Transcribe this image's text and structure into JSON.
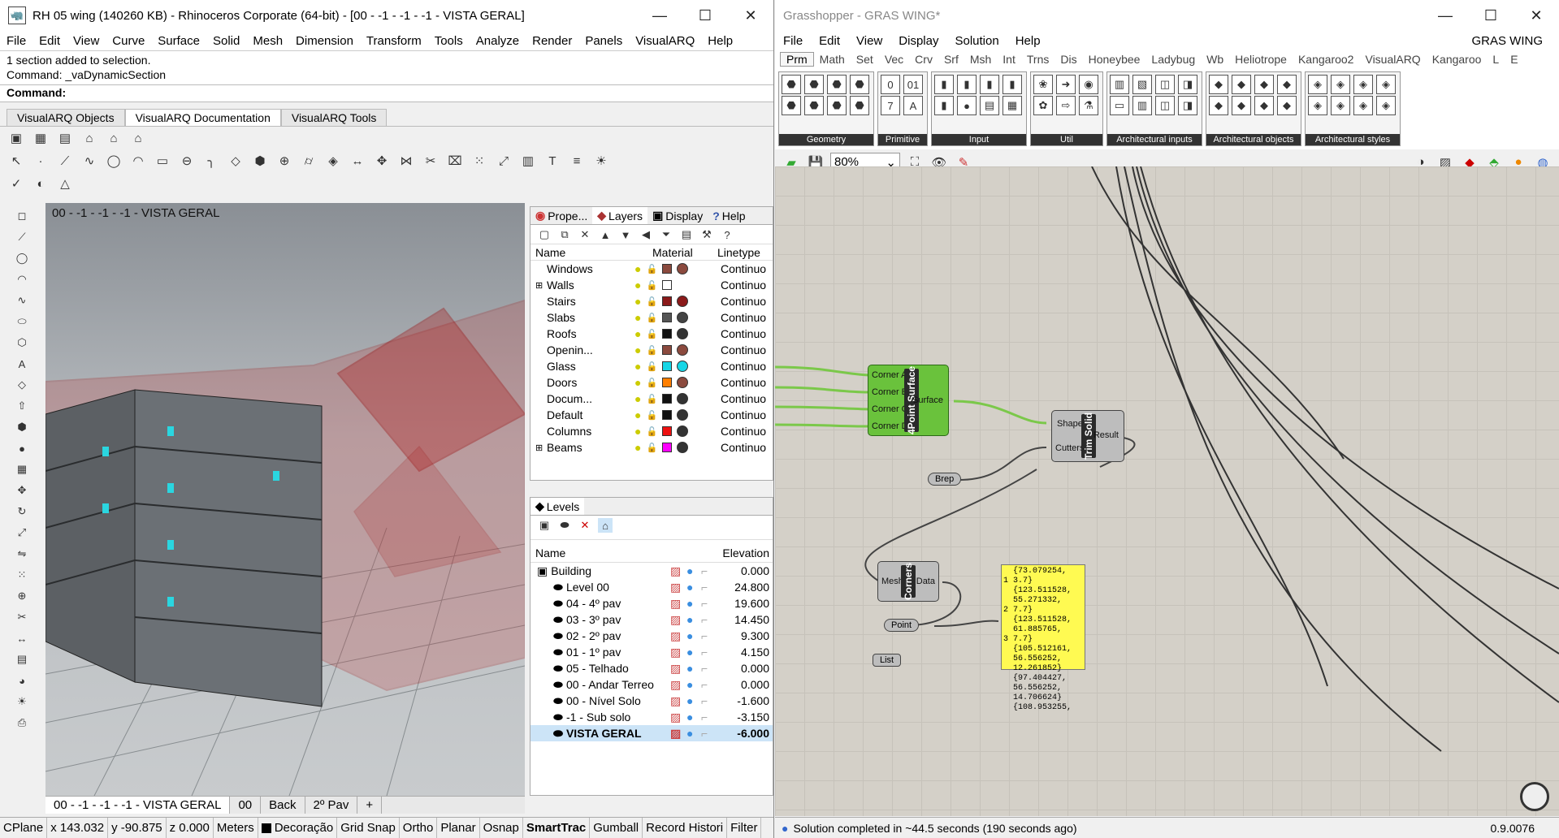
{
  "rhino": {
    "title": "RH 05 wing (140260 KB) - Rhinoceros Corporate (64-bit) - [00 - -1 - -1 - -1 - VISTA GERAL]",
    "menu": [
      "File",
      "Edit",
      "View",
      "Curve",
      "Surface",
      "Solid",
      "Mesh",
      "Dimension",
      "Transform",
      "Tools",
      "Analyze",
      "Render",
      "Panels",
      "VisualARQ",
      "Help"
    ],
    "history": [
      "1 section added to selection.",
      "Command: _vaDynamicSection"
    ],
    "command_label": "Command:",
    "toolbar_tabs": [
      "VisualARQ Objects",
      "VisualARQ Documentation",
      "VisualARQ Tools"
    ],
    "active_toolbar_tab": "VisualARQ Documentation",
    "viewport_title": "00 - -1 - -1 - -1 - VISTA GERAL",
    "viewport_tabs": [
      "00 - -1 - -1 - -1 - VISTA GERAL",
      "00",
      "Back",
      "2º Pav",
      "+"
    ],
    "panel_tabs": [
      "Prope...",
      "Layers",
      "Display",
      "Help"
    ],
    "layer_headers": {
      "name": "Name",
      "material": "Material",
      "linetype": "Linetype"
    },
    "layers": [
      {
        "name": "Windows",
        "color": "#8b4a3e",
        "mat": "#8b4a3e",
        "lt": "Continuo"
      },
      {
        "name": "Walls",
        "color": "#ffffff",
        "mat": "",
        "lt": "Continuo",
        "expand": "⊞"
      },
      {
        "name": "Stairs",
        "color": "#8b1a1a",
        "mat": "#8b1a1a",
        "lt": "Continuo"
      },
      {
        "name": "Slabs",
        "color": "#555555",
        "mat": "#444444",
        "lt": "Continuo"
      },
      {
        "name": "Roofs",
        "color": "#111111",
        "mat": "#333333",
        "lt": "Continuo"
      },
      {
        "name": "Openin...",
        "color": "#8b4a3e",
        "mat": "#8b4a3e",
        "lt": "Continuo"
      },
      {
        "name": "Glass",
        "color": "#17d6e6",
        "mat": "#17d6e6",
        "lt": "Continuo"
      },
      {
        "name": "Doors",
        "color": "#ff7f00",
        "mat": "#8b4a3e",
        "lt": "Continuo"
      },
      {
        "name": "Docum...",
        "color": "#111111",
        "mat": "#333333",
        "lt": "Continuo"
      },
      {
        "name": "Default",
        "color": "#111111",
        "mat": "#333333",
        "lt": "Continuo"
      },
      {
        "name": "Columns",
        "color": "#ee1111",
        "mat": "#333333",
        "lt": "Continuo"
      },
      {
        "name": "Beams",
        "color": "#ff00ff",
        "mat": "#333333",
        "lt": "Continuo",
        "expand": "⊞"
      }
    ],
    "levels_title": "Levels",
    "level_headers": {
      "name": "Name",
      "elevation": "Elevation"
    },
    "levels": [
      {
        "name": "Building",
        "el": "0.000",
        "indent": 0
      },
      {
        "name": "Level 00",
        "el": "24.800",
        "indent": 1
      },
      {
        "name": "04 - 4º pav",
        "el": "19.600",
        "indent": 1
      },
      {
        "name": "03 - 3º pav",
        "el": "14.450",
        "indent": 1
      },
      {
        "name": "02 - 2º pav",
        "el": "9.300",
        "indent": 1
      },
      {
        "name": "01 - 1º pav",
        "el": "4.150",
        "indent": 1
      },
      {
        "name": "05 - Telhado",
        "el": "0.000",
        "indent": 1
      },
      {
        "name": "00 - Andar Terreo",
        "el": "0.000",
        "indent": 1
      },
      {
        "name": "00 - Nível Solo",
        "el": "-1.600",
        "indent": 1
      },
      {
        "name": "-1 - Sub solo",
        "el": "-3.150",
        "indent": 1
      },
      {
        "name": "VISTA GERAL",
        "el": "-6.000",
        "indent": 1,
        "sel": true
      }
    ],
    "status": [
      "CPlane",
      "x 143.032",
      "y -90.875",
      "z 0.000",
      "Meters",
      "Decoração",
      "Grid Snap",
      "Ortho",
      "Planar",
      "Osnap",
      "SmartTrac",
      "Gumball",
      "Record Histori",
      "Filter"
    ]
  },
  "gh": {
    "title": "Grasshopper - GRAS WING*",
    "menu": [
      "File",
      "Edit",
      "View",
      "Display",
      "Solution",
      "Help"
    ],
    "doc_name": "GRAS WING",
    "tabs": [
      "Prm",
      "Math",
      "Set",
      "Vec",
      "Crv",
      "Srf",
      "Msh",
      "Int",
      "Trns",
      "Dis",
      "Honeybee",
      "Ladybug",
      "Wb",
      "Heliotrope",
      "Kangaroo2",
      "VisualARQ",
      "Kangaroo",
      "L",
      "E"
    ],
    "ribbon_groups": [
      "Geometry",
      "Primitive",
      "Input",
      "Util",
      "Architectural inputs",
      "Architectural objects",
      "Architectural styles"
    ],
    "zoom": "80%",
    "components": {
      "four_point": {
        "title": "4Point Surface",
        "inputs": [
          "Corner A",
          "Corner B",
          "Corner C",
          "Corner D"
        ],
        "output": "Surface"
      },
      "trim_solid": {
        "title": "Trim Solid",
        "inputs": [
          "Shape",
          "Cutters"
        ],
        "output": "Result"
      },
      "brep": "Brep",
      "corners": {
        "title": "Corners",
        "input": "Mesh",
        "output": "Data"
      },
      "point": "Point",
      "list": "List"
    },
    "panel_text": [
      "{73.079254, 3.7}",
      "{123.511528,",
      "55.271332, 7.7}",
      "{123.511528,",
      "61.885765, 7.7}",
      "{105.512161,",
      "56.556252,",
      "12.261852}",
      "{97.404427,",
      "56.556252,",
      "14.706624}",
      "{108.953255,"
    ],
    "panel_indices": [
      "1",
      "2",
      "3",
      "4"
    ],
    "status": "Solution completed in ~44.5 seconds (190 seconds ago)",
    "version": "0.9.0076"
  }
}
